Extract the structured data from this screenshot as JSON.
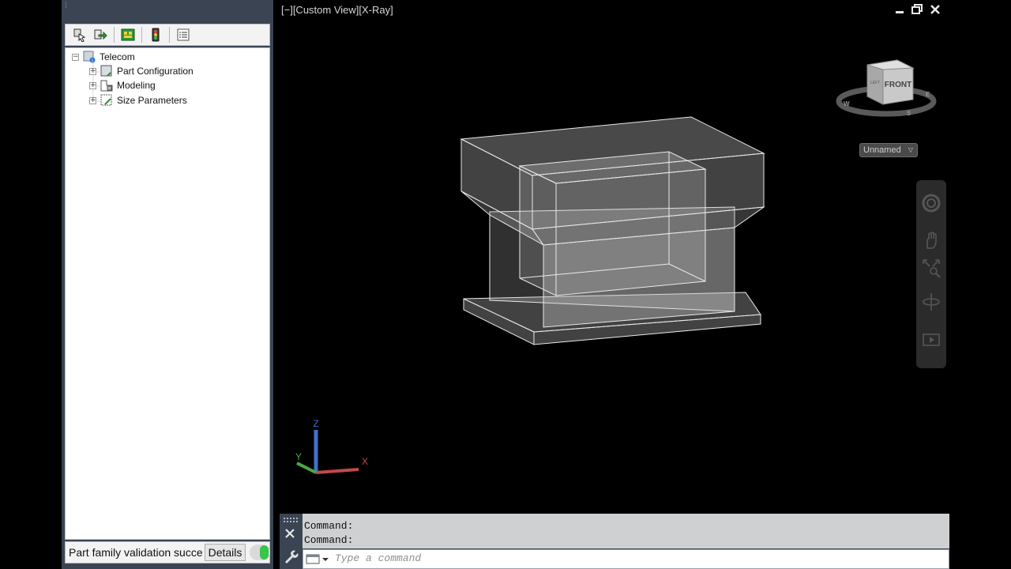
{
  "palette": {
    "toolbar_icons": [
      "part-builder-icon",
      "export-icon",
      "catalog-icon",
      "validate-icon",
      "list-icon"
    ],
    "tree": {
      "root": "Telecom",
      "children": [
        "Part Configuration",
        "Modeling",
        "Size Parameters"
      ]
    },
    "status": {
      "message": "Part family validation succes",
      "details_label": "Details",
      "indicator_color": "#37c54a"
    }
  },
  "viewport": {
    "label": "[−][Custom View][X-Ray]",
    "viewcube_face": "FRONT",
    "viewcube_side": "LEFT",
    "compass": [
      "W",
      "S",
      "E"
    ],
    "named_view": "Unnamed",
    "ucs_axes": [
      "X",
      "Y",
      "Z"
    ],
    "background": "#000000",
    "navbar_icons": [
      "steering-wheel-icon",
      "pan-icon",
      "zoom-icon",
      "orbit-icon",
      "showmotion-icon"
    ]
  },
  "command": {
    "history": [
      "Command:",
      "Command:"
    ],
    "placeholder": "Type a command"
  }
}
